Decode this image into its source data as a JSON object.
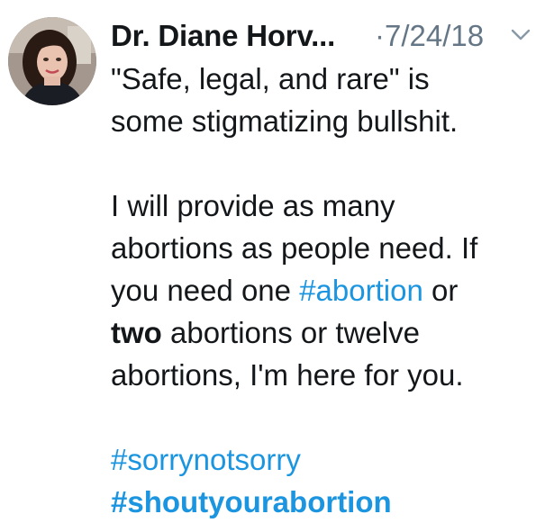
{
  "tweet": {
    "author_name": "Dr. Diane Horv...",
    "dot": "·",
    "date": "7/24/18",
    "paragraph1": [
      "\"Safe, legal, and rare\" is",
      "some stigmatizing bullshit."
    ],
    "paragraph2": {
      "line1": "I will provide as many",
      "line2": "abortions as people need. If",
      "line3_before": "you need one ",
      "line3_hashtag": "#abortion",
      "line3_after": " or",
      "line4_bold": "two",
      "line4_after": " abortions or twelve",
      "line5": "abortions, I'm here for you."
    },
    "hashtag1": "#sorrynotsorry",
    "hashtag2": "#shoutyourabortion"
  },
  "icons": {
    "menu": "chevron-down-icon"
  },
  "colors": {
    "text": "#14171a",
    "muted": "#657786",
    "link": "#1b95e0"
  }
}
